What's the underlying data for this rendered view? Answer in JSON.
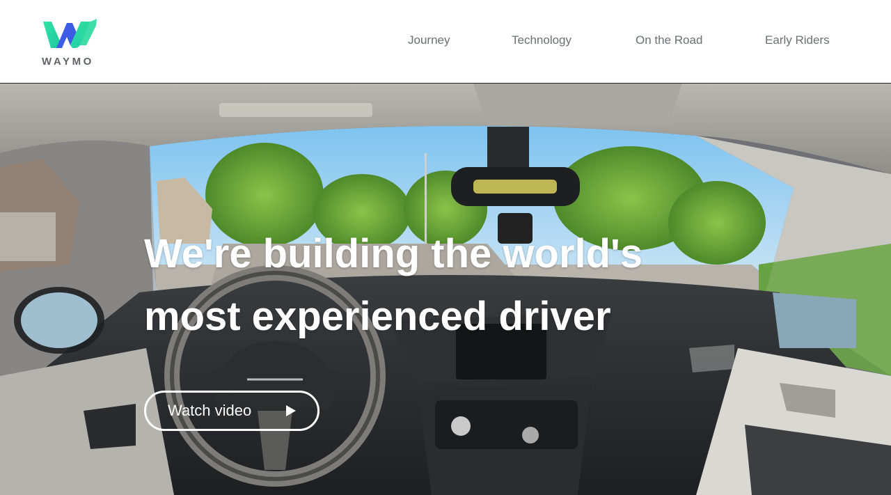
{
  "header": {
    "logo_text": "WAYMO",
    "nav": [
      {
        "label": "Journey"
      },
      {
        "label": "Technology"
      },
      {
        "label": "On the Road"
      },
      {
        "label": "Early Riders"
      }
    ]
  },
  "hero": {
    "headline_line1": "We're building the world's",
    "headline_line2": "most experienced driver",
    "cta_label": "Watch video"
  },
  "colors": {
    "brand_green": "#2bd99f",
    "brand_blue": "#3c5ce6",
    "nav_text": "#6b6f73"
  },
  "icons": {
    "logo": "waymo-w-logo-icon",
    "cta": "play-icon"
  }
}
